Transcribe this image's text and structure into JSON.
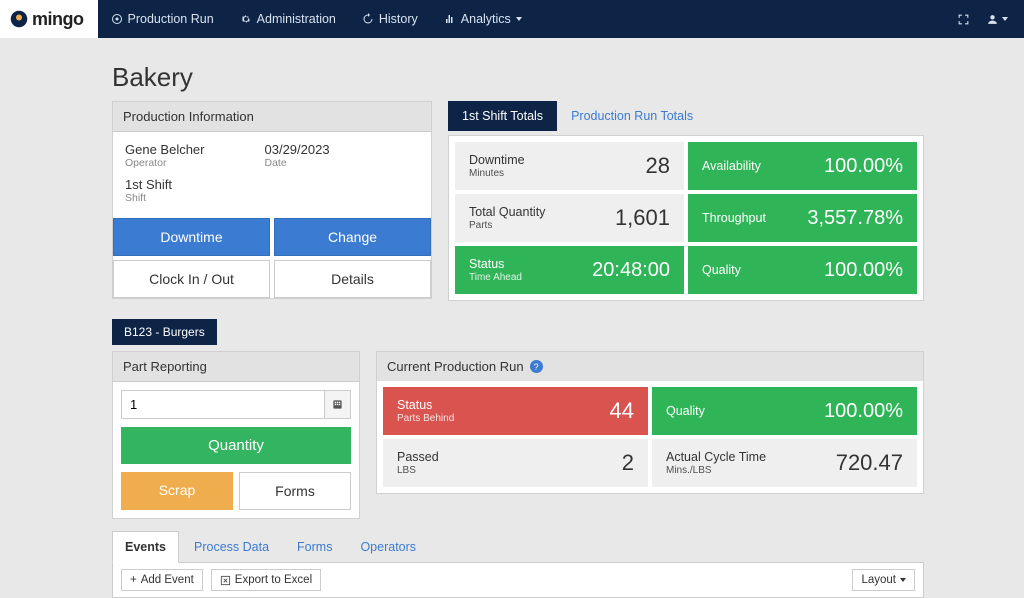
{
  "brand": "mingo",
  "nav": [
    {
      "label": "Production Run",
      "icon": "target"
    },
    {
      "label": "Administration",
      "icon": "gear"
    },
    {
      "label": "History",
      "icon": "history"
    },
    {
      "label": "Analytics",
      "icon": "chart",
      "dropdown": true
    }
  ],
  "page_title": "Bakery",
  "production_info": {
    "header": "Production Information",
    "operator": {
      "value": "Gene Belcher",
      "label": "Operator"
    },
    "date": {
      "value": "03/29/2023",
      "label": "Date"
    },
    "shift": {
      "value": "1st Shift",
      "label": "Shift"
    },
    "buttons": {
      "downtime": "Downtime",
      "change": "Change",
      "clock": "Clock In / Out",
      "details": "Details"
    }
  },
  "totals": {
    "tabs": {
      "shift": "1st Shift Totals",
      "run": "Production Run Totals"
    },
    "tiles": {
      "downtime": {
        "label": "Downtime",
        "sub": "Minutes",
        "value": "28"
      },
      "availability": {
        "label": "Availability",
        "value": "100.00%"
      },
      "totalqty": {
        "label": "Total Quantity",
        "sub": "Parts",
        "value": "1,601"
      },
      "throughput": {
        "label": "Throughput",
        "value": "3,557.78%"
      },
      "status": {
        "label": "Status",
        "sub": "Time Ahead",
        "value": "20:48:00"
      },
      "quality": {
        "label": "Quality",
        "value": "100.00%"
      }
    }
  },
  "part_chip": "B123 - Burgers",
  "part_reporting": {
    "header": "Part Reporting",
    "qty_input": "1",
    "quantity_btn": "Quantity",
    "scrap_btn": "Scrap",
    "forms_btn": "Forms"
  },
  "current_run": {
    "header": "Current Production Run",
    "tiles": {
      "status": {
        "label": "Status",
        "sub": "Parts Behind",
        "value": "44"
      },
      "quality": {
        "label": "Quality",
        "value": "100.00%"
      },
      "passed": {
        "label": "Passed",
        "sub": "LBS",
        "value": "2"
      },
      "cycle": {
        "label": "Actual Cycle Time",
        "sub": "Mins./LBS",
        "value": "720.47"
      }
    }
  },
  "bottom_tabs": {
    "events": "Events",
    "process": "Process Data",
    "forms": "Forms",
    "operators": "Operators"
  },
  "toolbar": {
    "add_event": "Add Event",
    "export": "Export to Excel",
    "layout": "Layout"
  }
}
